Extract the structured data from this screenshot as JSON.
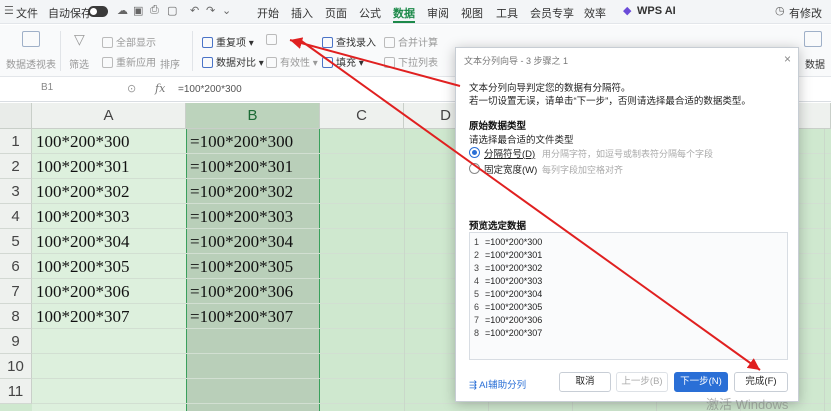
{
  "menubar": {
    "file": "文件",
    "autosave": "自动保存",
    "tabs": [
      "开始",
      "插入",
      "页面",
      "公式",
      "数据",
      "审阅",
      "视图",
      "工具",
      "会员专享",
      "效率"
    ],
    "active_tab": "数据",
    "wps_ai": "WPS AI",
    "collab": "有修改"
  },
  "ribbon": {
    "pivot": "数据透视表",
    "filter": "筛选",
    "show_all": "全部显示",
    "reapply": "重新应用",
    "sort": "排序",
    "duplicates": "重复项",
    "compare": "数据对比",
    "validity": "有效性",
    "fill": "填充",
    "lookup_entry": "查找录入",
    "merge_calc": "合并计算",
    "dropdown_list": "下拉列表",
    "data_right": "数据"
  },
  "formula_bar": {
    "cell_ref": "B1",
    "fx": "fx",
    "content": "=100*200*300"
  },
  "sheet": {
    "columns": [
      "A",
      "B",
      "C",
      "D"
    ],
    "rows": [
      "1",
      "2",
      "3",
      "4",
      "5",
      "6",
      "7",
      "8",
      "9",
      "10",
      "11"
    ],
    "col_a": [
      "100*200*300",
      "100*200*301",
      "100*200*302",
      "100*200*303",
      "100*200*304",
      "100*200*305",
      "100*200*306",
      "100*200*307"
    ],
    "col_b": [
      "=100*200*300",
      "=100*200*301",
      "=100*200*302",
      "=100*200*303",
      "=100*200*304",
      "=100*200*305",
      "=100*200*306",
      "=100*200*307"
    ]
  },
  "dialog": {
    "title": "文本分列向导 - 3 步骤之 1",
    "close": "×",
    "intro1": "文本分列向导判定您的数据有分隔符。",
    "intro2": "若一切设置无误，请单击“下一步”，否则请选择最合适的数据类型。",
    "section_original": "原始数据类型",
    "choose_type": "请选择最合适的文件类型",
    "option_delimited": "分隔符号(D)",
    "option_delimited_hint": "用分隔字符，如逗号或制表符分隔每个字段",
    "option_fixed": "固定宽度(W)",
    "option_fixed_hint": "每列字段加空格对齐",
    "preview_label": "预览选定数据",
    "preview_lines": [
      "=100*200*300",
      "=100*200*301",
      "=100*200*302",
      "=100*200*303",
      "=100*200*304",
      "=100*200*305",
      "=100*200*306",
      "=100*200*307"
    ],
    "preview_nums": [
      "1",
      "2",
      "3",
      "4",
      "5",
      "6",
      "7",
      "8"
    ],
    "ai_split": "AI辅助分列",
    "cancel": "取消",
    "prev": "上一步(B)",
    "next": "下一步(N)",
    "finish": "完成(F)"
  },
  "watermark": "激活 Windows"
}
